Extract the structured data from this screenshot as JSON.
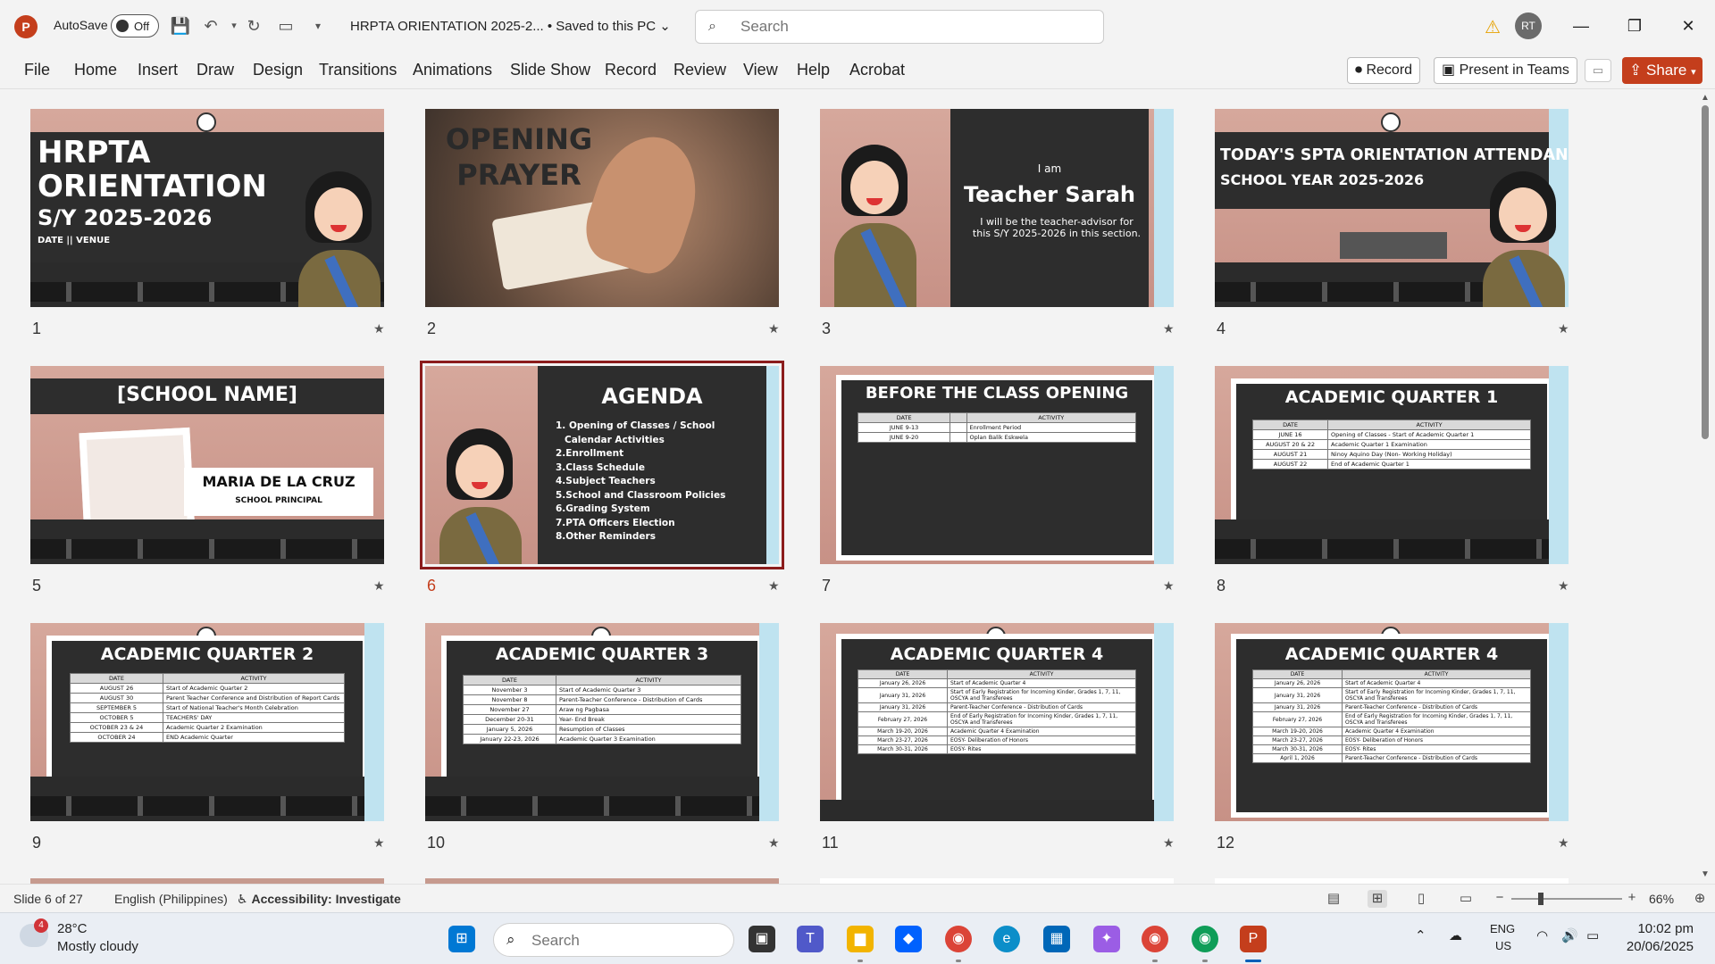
{
  "titlebar": {
    "app_logo": "P",
    "autosave_label": "AutoSave",
    "autosave_state": "Off",
    "doc_title": "HRPTA ORIENTATION 2025-2...  •  Saved to this PC",
    "search_placeholder": "Search",
    "avatar_initials": "RT"
  },
  "ribbon": {
    "tabs": [
      "File",
      "Home",
      "Insert",
      "Draw",
      "Design",
      "Transitions",
      "Animations",
      "Slide Show",
      "Record",
      "Review",
      "View",
      "Help",
      "Acrobat"
    ],
    "record_label": "Record",
    "present_label": "Present in Teams",
    "share_label": "Share"
  },
  "slides": [
    {
      "number": "1",
      "title": "HRPTA ORIENTATION",
      "subtitle": "S/Y 2025-2026",
      "line": "DATE || VENUE"
    },
    {
      "number": "2",
      "title": "OPENING PRAYER"
    },
    {
      "number": "3",
      "pre": "I am",
      "title": "Teacher Sarah",
      "body": "I will be the  teacher-advisor for this S/Y 2025-2026 in this section."
    },
    {
      "number": "4",
      "title": "TODAY'S SPTA ORIENTATION ATTENDANCE",
      "subtitle": "SCHOOL YEAR 2025-2026"
    },
    {
      "number": "5",
      "title": "[SCHOOL NAME]",
      "name": "MARIA DE LA CRUZ",
      "role": "SCHOOL PRINCIPAL"
    },
    {
      "number": "6",
      "title": "AGENDA",
      "items": [
        "1. Opening of Classes / School",
        "Calendar Activities",
        "2.Enrollment",
        "3.Class Schedule",
        "4.Subject Teachers",
        "5.School and Classroom Policies",
        "6.Grading System",
        "7.PTA Officers Election",
        "8.Other Reminders"
      ]
    },
    {
      "number": "7",
      "title": "BEFORE THE CLASS OPENING",
      "headers": [
        "DATE",
        "",
        "ACTIVITY"
      ],
      "rows": [
        [
          "JUNE 9-13",
          "",
          "Enrollment Period"
        ],
        [
          "JUNE 9-20",
          "",
          "Oplan Balik Eskwela"
        ]
      ]
    },
    {
      "number": "8",
      "title": "ACADEMIC QUARTER 1",
      "headers": [
        "DATE",
        "ACTIVITY"
      ],
      "rows": [
        [
          "JUNE 16",
          "Opening of Classes - Start of Academic Quarter 1"
        ],
        [
          "AUGUST 20 & 22",
          "Academic Quarter 1 Examination"
        ],
        [
          "AUGUST 21",
          "Ninoy Aquino Day (Non- Working Holiday)"
        ],
        [
          "AUGUST 22",
          "End of  Academic Quarter 1"
        ]
      ]
    },
    {
      "number": "9",
      "title": "ACADEMIC QUARTER 2",
      "headers": [
        "DATE",
        "ACTIVITY"
      ],
      "rows": [
        [
          "AUGUST 26",
          "Start of Academic Quarter 2"
        ],
        [
          "AUGUST 30",
          "Parent Teacher Conference and Distribution of Report Cards"
        ],
        [
          "SEPTEMBER 5",
          "Start of National Teacher's Month Celebration"
        ],
        [
          "OCTOBER 5",
          "TEACHERS' DAY"
        ],
        [
          "OCTOBER 23 & 24",
          "Academic Quarter 2 Examination"
        ],
        [
          "OCTOBER 24",
          "END Academic Quarter"
        ]
      ]
    },
    {
      "number": "10",
      "title": "ACADEMIC QUARTER 3",
      "headers": [
        "DATE",
        "ACTIVITY"
      ],
      "rows": [
        [
          "November 3",
          "Start of Academic Quarter 3"
        ],
        [
          "November 8",
          "Parent-Teacher Conference - Distribution of Cards"
        ],
        [
          "November 27",
          "Araw ng Pagbasa"
        ],
        [
          "December 20-31",
          "Year- End Break"
        ],
        [
          "January 5, 2026",
          "Resumption of Classes"
        ],
        [
          "January 22-23, 2026",
          "Academic Quarter 3 Examination"
        ]
      ]
    },
    {
      "number": "11",
      "title": "ACADEMIC QUARTER 4",
      "headers": [
        "DATE",
        "ACTIVITY"
      ],
      "rows": [
        [
          "January 26, 2026",
          "Start of Academic Quarter 4"
        ],
        [
          "January 31, 2026",
          "Start of Early Registration for Incoming Kinder, Grades 1, 7, 11, OSCYA and Transferees"
        ],
        [
          "January 31, 2026",
          "Parent-Teacher Conference - Distribution of Cards"
        ],
        [
          "February 27, 2026",
          "End of Early Registration for Incoming Kinder, Grades 1, 7, 11, OSCYA and Transferees"
        ],
        [
          "March 19-20, 2026",
          "Academic Quarter 4 Examination"
        ],
        [
          "March 23-27, 2026",
          "EOSY- Deliberation of Honors"
        ],
        [
          "March 30-31, 2026",
          "EOSY- Rites"
        ]
      ]
    },
    {
      "number": "12",
      "title": "ACADEMIC QUARTER 4",
      "headers": [
        "DATE",
        "ACTIVITY"
      ],
      "rows": [
        [
          "January 26, 2026",
          "Start of Academic Quarter 4"
        ],
        [
          "January 31, 2026",
          "Start of Early Registration for Incoming Kinder, Grades 1, 7, 11, OSCYA and Transferees"
        ],
        [
          "January 31, 2026",
          "Parent-Teacher Conference - Distribution of Cards"
        ],
        [
          "February 27, 2026",
          "End of Early Registration for Incoming Kinder, Grades 1, 7, 11, OSCYA and Transferees"
        ],
        [
          "March 19-20, 2026",
          "Academic Quarter 4 Examination"
        ],
        [
          "March 23-27, 2026",
          "EOSY- Deliberation of Honors"
        ],
        [
          "March 30-31, 2026",
          "EOSY- Rites"
        ],
        [
          "April 1, 2026",
          "Parent-Teacher Conference - Distribution of Cards"
        ]
      ]
    }
  ],
  "selected_slide": "6",
  "statusbar": {
    "slide_info": "Slide 6 of 27",
    "language": "English (Philippines)",
    "accessibility": "Accessibility: Investigate",
    "zoom": "66%"
  },
  "taskbar": {
    "weather_badge": "4",
    "temperature": "28°C",
    "condition": "Mostly cloudy",
    "search_placeholder": "Search",
    "lang_line1": "ENG",
    "lang_line2": "US",
    "time": "10:02 pm",
    "date": "20/06/2025"
  },
  "colors": {
    "accent": "#c43e1c",
    "selected_outline": "#8b1c1c",
    "board": "#2d2d2d",
    "wall": "#d6a89c",
    "taskbar_active": "#005fb8"
  }
}
